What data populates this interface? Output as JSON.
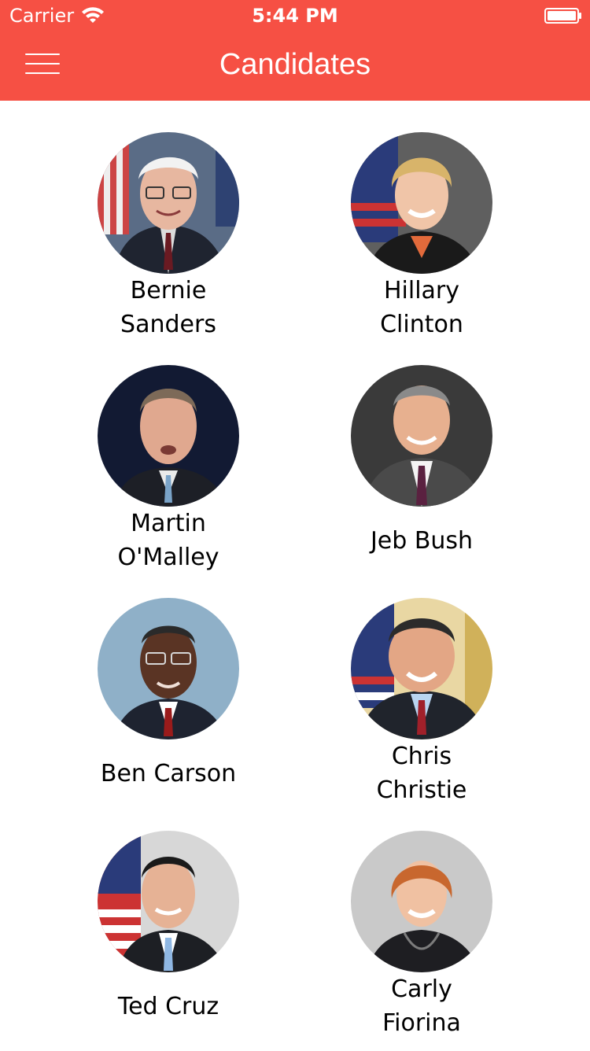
{
  "status_bar": {
    "carrier": "Carrier",
    "time": "5:44 PM"
  },
  "header": {
    "title": "Candidates",
    "menu_icon": "hamburger-menu-icon"
  },
  "candidates": [
    {
      "first": "Bernie",
      "last": "Sanders"
    },
    {
      "first": "Hillary",
      "last": "Clinton"
    },
    {
      "first": "Martin",
      "last": "O'Malley"
    },
    {
      "first": "Jeb Bush",
      "last": ""
    },
    {
      "first": "Ben Carson",
      "last": ""
    },
    {
      "first": "Chris",
      "last": "Christie"
    },
    {
      "first": "Ted Cruz",
      "last": ""
    },
    {
      "first": "Carly",
      "last": "Fiorina"
    }
  ],
  "colors": {
    "header": "#F65044",
    "text": "#000000"
  }
}
